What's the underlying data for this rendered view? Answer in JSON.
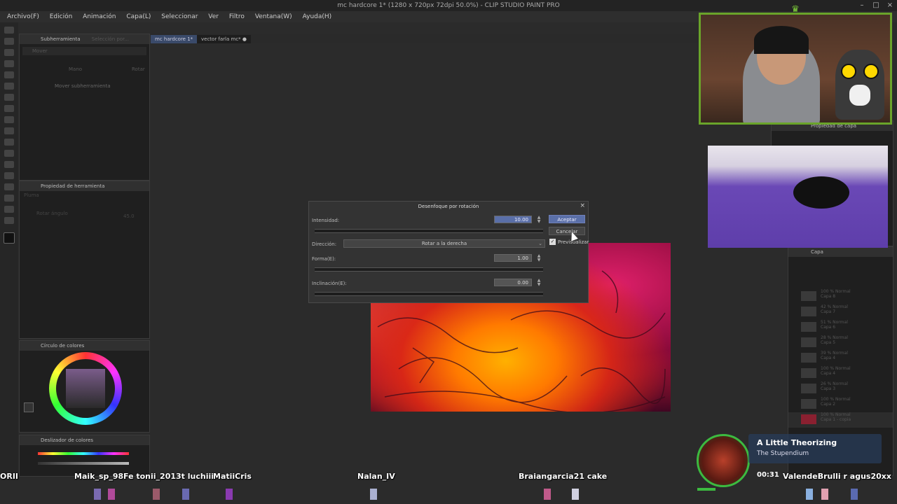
{
  "window": {
    "title": "mc hardcore 1* (1280 x 720px 72dpi 50.0%) - CLIP STUDIO PAINT PRO"
  },
  "menu": [
    "Archivo(F)",
    "Edición",
    "Animación",
    "Capa(L)",
    "Seleccionar",
    "Ver",
    "Filtro",
    "Ventana(W)",
    "Ayuda(H)"
  ],
  "tabs": [
    {
      "label": "mc hardcore 1*"
    },
    {
      "label": "vector farla mc*"
    }
  ],
  "panels": {
    "subtool": {
      "title": "Subherramienta",
      "tab2": "Selección por...",
      "item": "Mover",
      "sub_item": "Mover subherramienta",
      "hand_label": "Mano",
      "rotate_label": "Rotar"
    },
    "tool_property": {
      "title": "Propiedad de herramienta",
      "field1": "Pluma",
      "field2": "Rotar ángulo",
      "value": "45.0"
    },
    "color_circle": {
      "title": "Círculo de colores"
    },
    "color_slider": {
      "title": "Deslizador de colores"
    },
    "layer_property": {
      "title": "Propiedad de capa"
    },
    "layers": {
      "title": "Capa",
      "items": [
        {
          "opacity": "100 % Normal",
          "name": "Capa 8"
        },
        {
          "opacity": "42 % Normal",
          "name": "Capa 7"
        },
        {
          "opacity": "51 % Normal",
          "name": "Capa 6"
        },
        {
          "opacity": "28 % Normal",
          "name": "Capa 5"
        },
        {
          "opacity": "39 % Normal",
          "name": "Capa 4"
        },
        {
          "opacity": "100 % Normal",
          "name": "Capa 4"
        },
        {
          "opacity": "26 % Normal",
          "name": "Capa 3"
        },
        {
          "opacity": "100 % Normal",
          "name": "Capa 2"
        },
        {
          "opacity": "100 % Normal",
          "name": "Capa 1 - copia"
        }
      ]
    }
  },
  "dialog": {
    "title": "Desenfoque por rotación",
    "intensity_label": "Intensidad:",
    "intensity_value": "10.00",
    "direction_label": "Dirección:",
    "direction_value": "Rotar a la derecha",
    "shape_label": "Forma(E):",
    "shape_value": "1.00",
    "tilt_label": "Inclinación(E):",
    "tilt_value": "0.00",
    "accept_label": "Aceptar",
    "cancel_label": "Cancelar",
    "preview_label": "Previsualizar",
    "preview_checked": true
  },
  "stream": {
    "chat_names": [
      "ORII",
      "Maik_sp_98",
      "Fe tonii_2013t luchiii",
      "MatiiCris",
      "Nalan_IV",
      "Braiangarcia21 cake",
      "ValendeBrulli r agus20xx"
    ],
    "now_playing_title": "A Little Theorizing",
    "now_playing_artist": "The Stupendium",
    "timer": "00:31"
  },
  "colors": {
    "accent_green": "#6aa42a",
    "dialog_button": "#5a6fa8"
  }
}
